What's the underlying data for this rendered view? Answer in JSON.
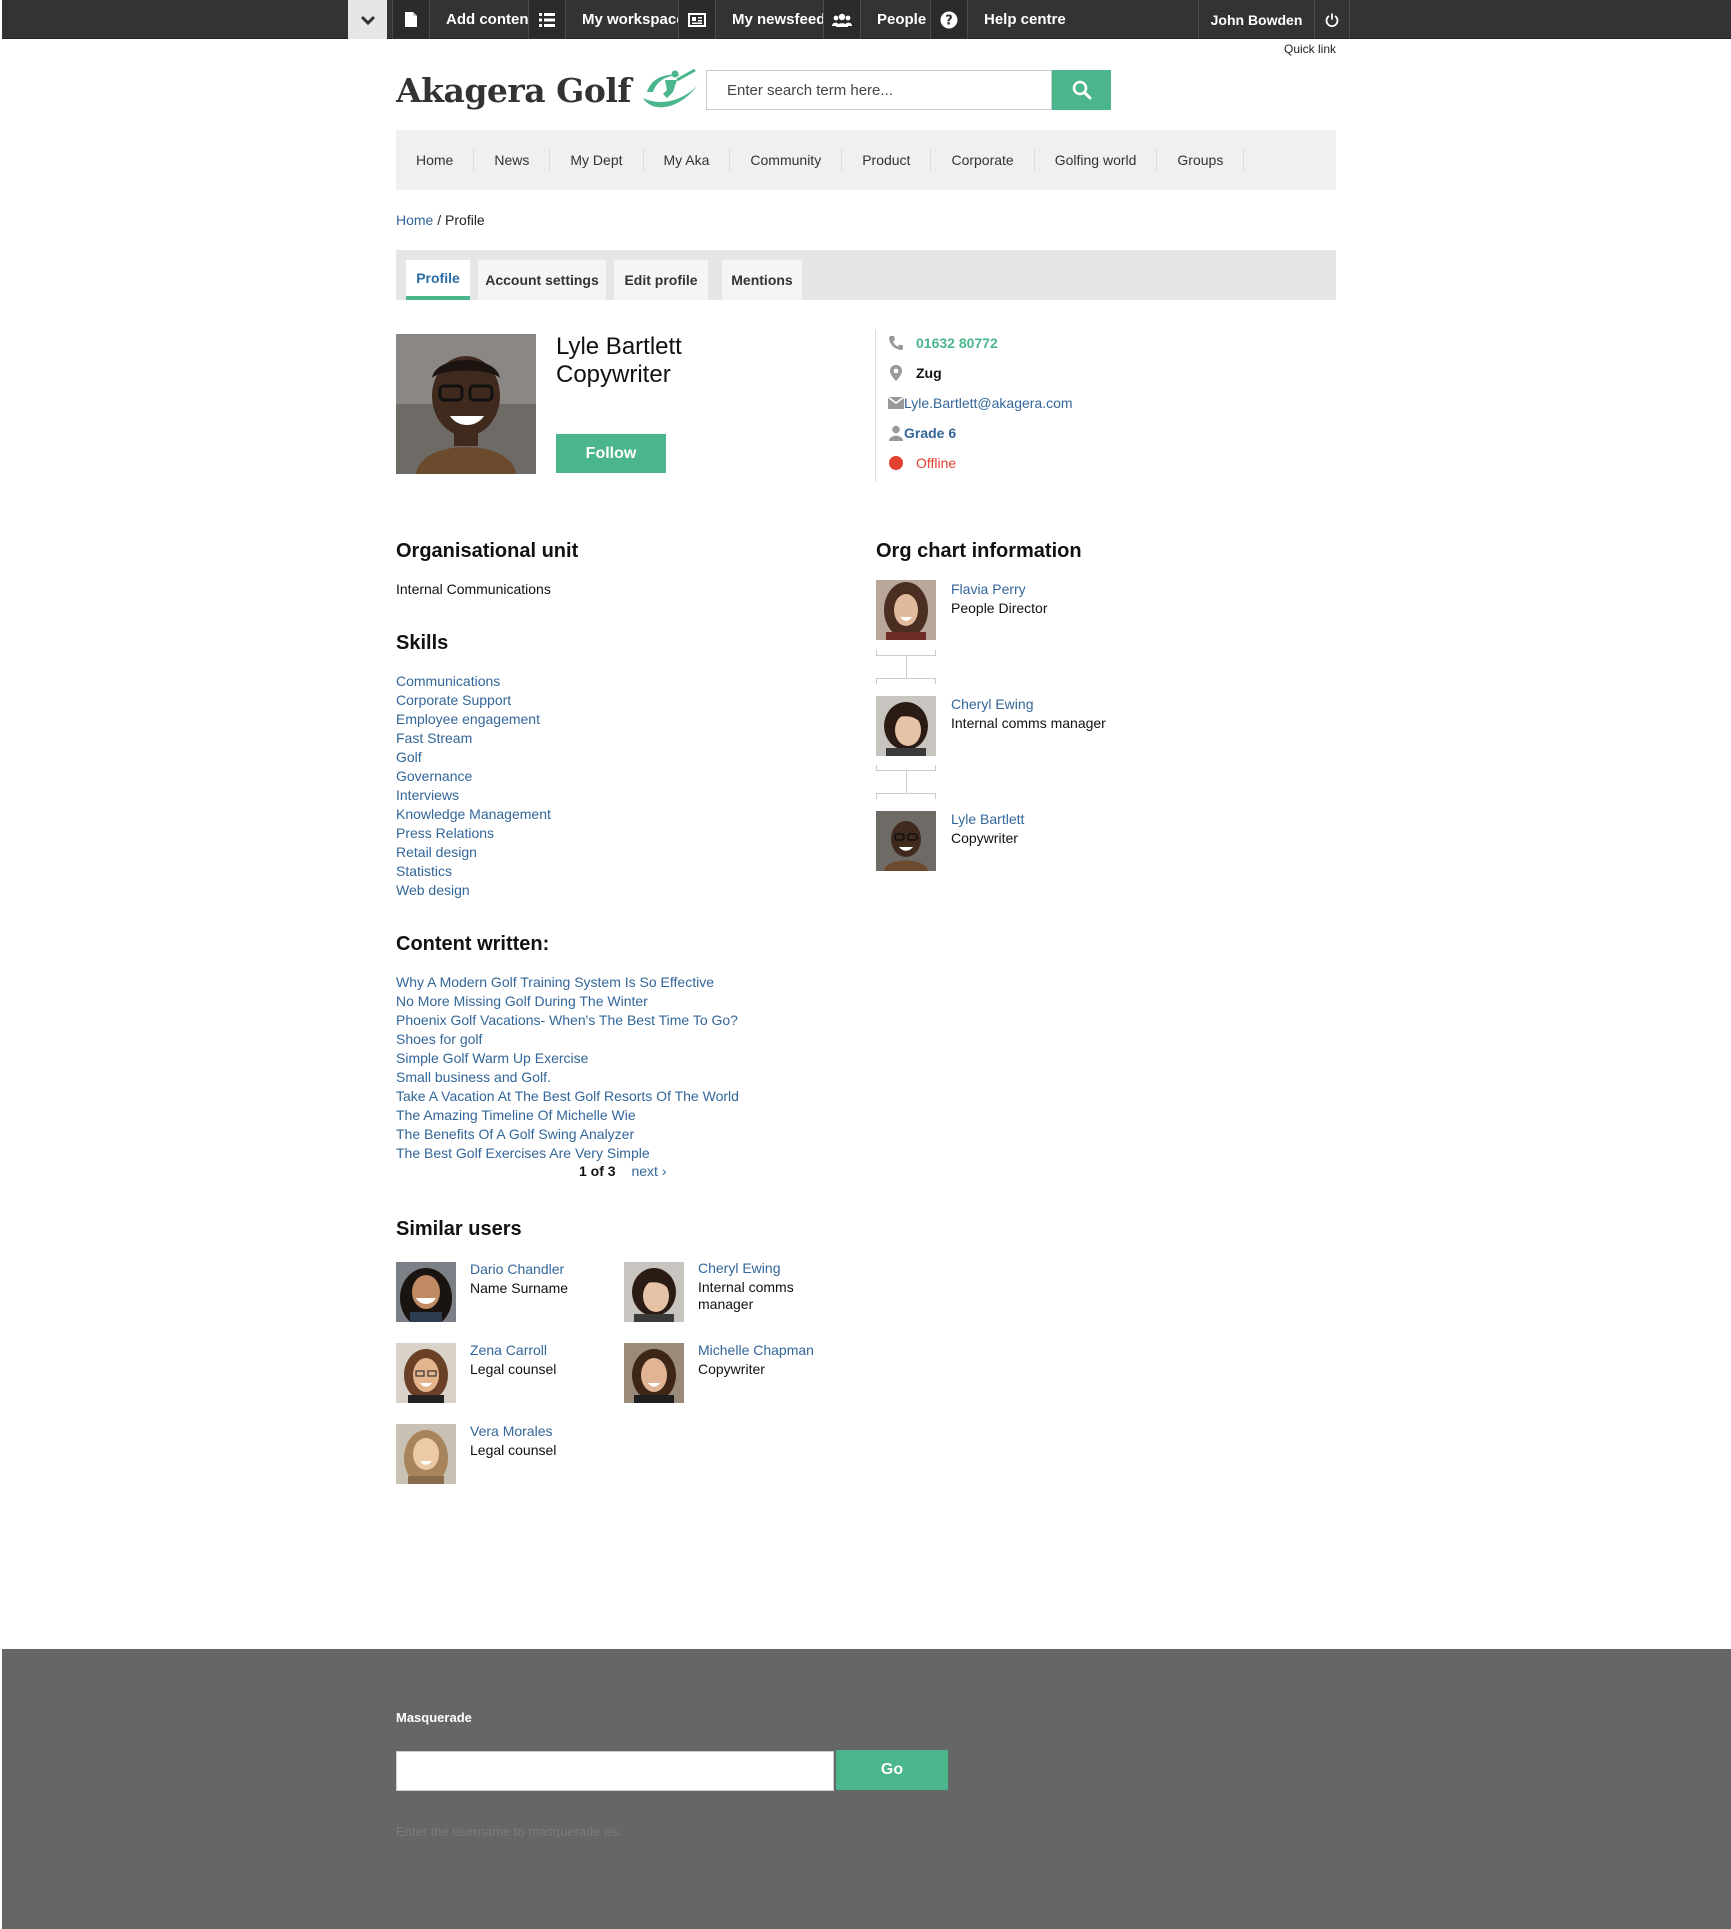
{
  "toolbar": {
    "items": [
      {
        "label": "Add content",
        "icon": "file-icon"
      },
      {
        "label": "My workspace",
        "icon": "list-icon"
      },
      {
        "label": "My newsfeed",
        "icon": "newspaper-icon"
      },
      {
        "label": "People",
        "icon": "people-icon"
      },
      {
        "label": "Help centre",
        "icon": "help-icon"
      }
    ],
    "user": "John Bowden",
    "quick_link": "Quick link"
  },
  "site": {
    "logo_text": "Akagera Golf",
    "search_placeholder": "Enter search term here...",
    "accent_color": "#4bb58b",
    "link_color": "#336699"
  },
  "nav": [
    "Home",
    "News",
    "My Dept",
    "My Aka",
    "Community",
    "Product",
    "Corporate",
    "Golfing world",
    "Groups"
  ],
  "breadcrumb": {
    "home": "Home",
    "separator": " / ",
    "current": "Profile"
  },
  "tabs": [
    "Profile",
    "Account settings",
    "Edit profile",
    "Mentions"
  ],
  "profile": {
    "name": "Lyle Bartlett",
    "title": "Copywriter",
    "follow_label": "Follow",
    "phone": "01632 80772",
    "location": "Zug",
    "email": "Lyle.Bartlett@akagera.com",
    "grade": "Grade 6",
    "status": "Offline",
    "status_color": "#e2412f"
  },
  "org_unit": {
    "heading": "Organisational unit",
    "value": "Internal Communications"
  },
  "skills": {
    "heading": "Skills",
    "items": [
      "Communications",
      "Corporate Support",
      "Employee engagement",
      "Fast Stream",
      "Golf",
      "Governance",
      "Interviews",
      "Knowledge Management",
      "Press Relations",
      "Retail design",
      "Statistics",
      "Web design"
    ]
  },
  "org_chart": {
    "heading": "Org chart information",
    "people": [
      {
        "name": "Flavia Perry",
        "role": "People Director"
      },
      {
        "name": "Cheryl Ewing",
        "role": "Internal comms manager"
      },
      {
        "name": "Lyle Bartlett",
        "role": "Copywriter"
      }
    ]
  },
  "content_written": {
    "heading": "Content written:",
    "items": [
      "Why A Modern Golf Training System Is So Effective",
      "No More Missing Golf During The Winter",
      "Phoenix Golf Vacations- When's The Best Time To Go?",
      "Shoes for golf",
      "Simple Golf Warm Up Exercise",
      "Small business and Golf.",
      "Take A Vacation At The Best Golf Resorts Of The World",
      "The Amazing Timeline Of Michelle Wie",
      "The Benefits Of A Golf Swing Analyzer",
      "The Best Golf Exercises Are Very Simple"
    ],
    "pager": {
      "current": "1 of 3",
      "next": "next ›"
    }
  },
  "similar_users": {
    "heading": "Similar users",
    "users": [
      {
        "name": "Dario Chandler",
        "role": "Name Surname"
      },
      {
        "name": "Cheryl Ewing",
        "role_line1": "Internal comms",
        "role_line2": "manager"
      },
      {
        "name": "Zena Carroll",
        "role": "Legal counsel"
      },
      {
        "name": "Michelle Chapman",
        "role": "Copywriter"
      },
      {
        "name": "Vera Morales",
        "role": "Legal counsel"
      }
    ]
  },
  "footer": {
    "masquerade_label": "Masquerade",
    "go_label": "Go",
    "help_text": "Enter the username to masquerade as."
  }
}
